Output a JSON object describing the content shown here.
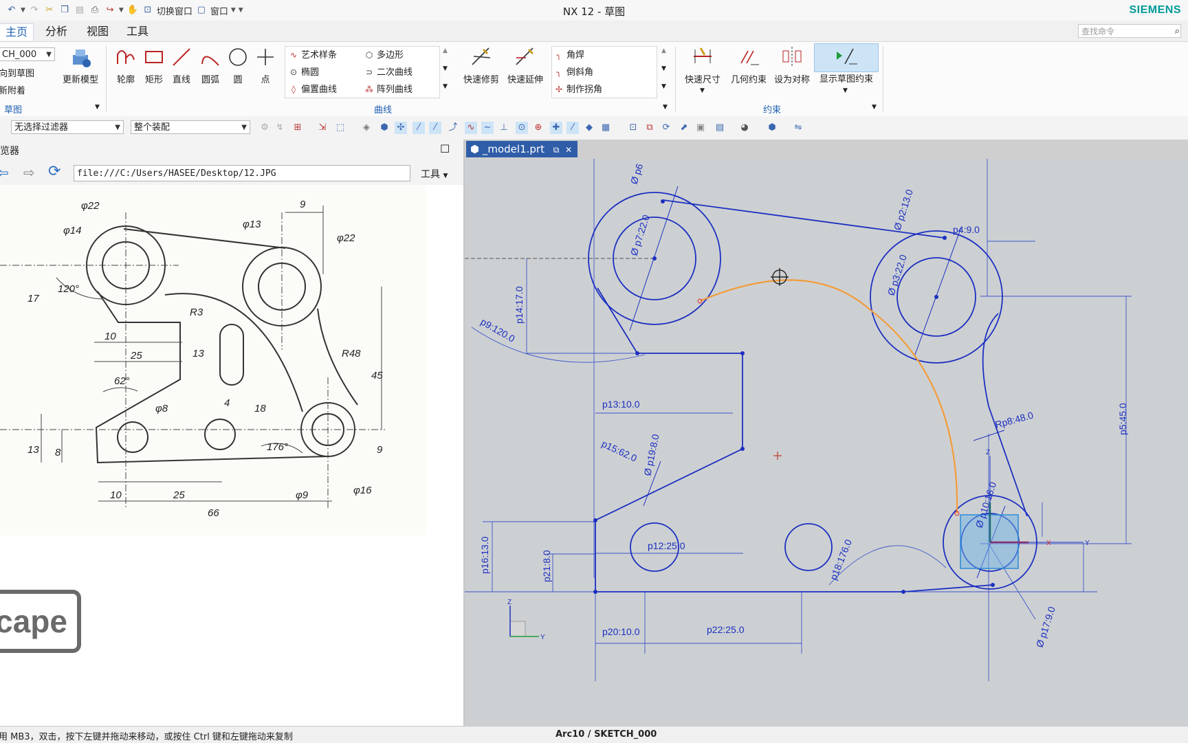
{
  "window": {
    "title": "NX 12 - 草图",
    "brand": "SIEMENS"
  },
  "quick_access": {
    "switch_window": "切换窗口",
    "window": "窗口"
  },
  "tabs": [
    "主页",
    "分析",
    "视图",
    "工具"
  ],
  "search": {
    "placeholder": "查找命令"
  },
  "ribbon": {
    "sketch_name": "CH_000",
    "sketch_group": {
      "goto_sketch": "向到草图",
      "reattach": "新附着",
      "update_model": "更新模型",
      "label": "草图"
    },
    "big_buttons": [
      "轮廓",
      "矩形",
      "直线",
      "圆弧",
      "圆",
      "点"
    ],
    "curve_list_col1": [
      "艺术样条",
      "椭圆",
      "偏置曲线"
    ],
    "curve_list_col2": [
      "多边形",
      "二次曲线",
      "阵列曲线"
    ],
    "trim": [
      "快速修剪",
      "快速延伸"
    ],
    "corner_list": [
      "角焊",
      "倒斜角",
      "制作拐角"
    ],
    "curve_label": "曲线",
    "constraint_buttons": [
      "快速尺寸",
      "几何约束",
      "设为对称",
      "显示草图约束"
    ],
    "constraint_label": "约束"
  },
  "filterbar": {
    "filter": "无选择过滤器",
    "assembly": "整个装配"
  },
  "browser": {
    "title": "览器",
    "url": "file:///C:/Users/HASEE/Desktop/12.JPG",
    "tools": "工具"
  },
  "drawing_labels": {
    "phi22a": "φ22",
    "phi14": "φ14",
    "nine_top": "9",
    "phi13": "φ13",
    "phi22b": "φ22",
    "ang120": "120°",
    "r3": "R3",
    "seventeen": "17",
    "ten_a": "10",
    "twentyfive_a": "25",
    "thirteen_a": "13",
    "r48": "R48",
    "fortyfive": "45",
    "ang62": "62°",
    "phi8": "φ8",
    "four": "4",
    "eighteen": "18",
    "ang176": "176°",
    "thirteen_b": "13",
    "eight": "8",
    "nine_r": "9",
    "ten_b": "10",
    "twentyfive_b": "25",
    "phi9": "φ9",
    "phi16": "φ16",
    "sixtysix": "66"
  },
  "escape_key": "cape",
  "graphics": {
    "tab": "_model1.prt",
    "dims": {
      "p6": "Ø p6",
      "p7": "Ø p7:22.0",
      "p2": "Ø p2:13.0",
      "p4": "p4:9.0",
      "p3": "Ø p3:22.0",
      "p14": "p14:17.0",
      "p9": "p9:120.0",
      "p13": "p13:10.0",
      "p15": "p15:62.0",
      "p19": "Ø p19:8.0",
      "p12": "p12:25.0",
      "p16": "p16:13.0",
      "p21": "p21:8.0",
      "p18": "p18:176.0",
      "p8": "Rp8:48.0",
      "p5": "p5:45.0",
      "p10": "Ø p10:16.0",
      "p17": "Ø p17:9.0",
      "p20": "p20:10.0",
      "p22": "p22:25.0",
      "ax_z": "Z",
      "ax_x": "X",
      "ax_y": "Y"
    }
  },
  "status": {
    "hint": "用 MB3，双击，按下左键并拖动来移动，或按住 Ctrl 键和左键拖动来复制",
    "selection": "Arc10 / SKETCH_000"
  }
}
